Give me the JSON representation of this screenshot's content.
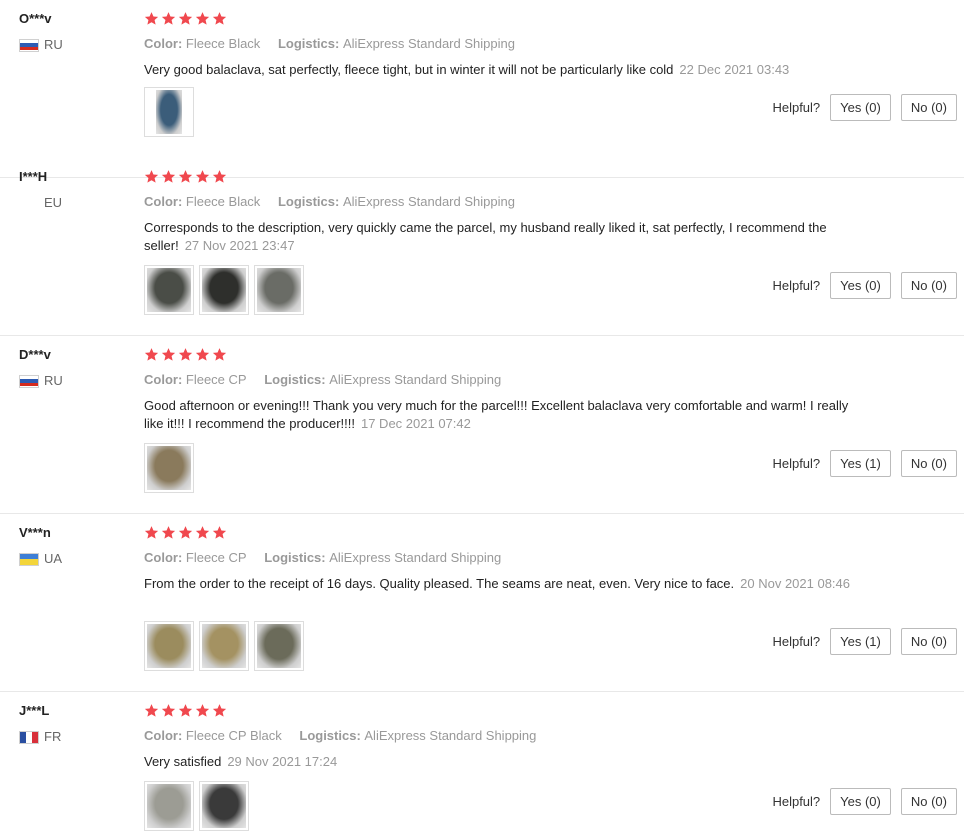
{
  "labels": {
    "color": "Color:",
    "logistics": "Logistics:",
    "helpful": "Helpful?"
  },
  "colors": {
    "star": "#f0484e",
    "text": "#222222",
    "muted": "#999999",
    "border": "#e8e8e8"
  },
  "reviews": [
    {
      "user": "O***v",
      "country": "RU",
      "flag_icon": "russia-flag-icon",
      "rating": 5,
      "color": "Fleece Black",
      "logistics": "AliExpress Standard Shipping",
      "text": "Very good balaclava, sat perfectly, fleece tight, but in winter it will not be particularly like cold",
      "date": "22 Dec 2021 03:43",
      "photo_count": 1,
      "yes": "Yes (0)",
      "no": "No (0)"
    },
    {
      "user": "I***H",
      "country": "EU",
      "flag_icon": "",
      "rating": 5,
      "color": "Fleece Black",
      "logistics": "AliExpress Standard Shipping",
      "text": "Corresponds to the description, very quickly came the parcel, my husband really liked it, sat perfectly, I recommend the seller!",
      "date": "27 Nov 2021 23:47",
      "photo_count": 3,
      "yes": "Yes (0)",
      "no": "No (0)"
    },
    {
      "user": "D***v",
      "country": "RU",
      "flag_icon": "russia-flag-icon",
      "rating": 5,
      "color": "Fleece CP",
      "logistics": "AliExpress Standard Shipping",
      "text": "Good afternoon or evening!!! Thank you very much for the parcel!!! Excellent balaclava very comfortable and warm! I really like it!!! I recommend the producer!!!!",
      "date": "17 Dec 2021 07:42",
      "photo_count": 1,
      "yes": "Yes (1)",
      "no": "No (0)"
    },
    {
      "user": "V***n",
      "country": "UA",
      "flag_icon": "ukraine-flag-icon",
      "rating": 5,
      "color": "Fleece CP",
      "logistics": "AliExpress Standard Shipping",
      "text": "From the order to the receipt of 16 days. Quality pleased. The seams are neat, even. Very nice to face.",
      "date": "20 Nov 2021 08:46",
      "photo_count": 3,
      "yes": "Yes (1)",
      "no": "No (0)"
    },
    {
      "user": "J***L",
      "country": "FR",
      "flag_icon": "france-flag-icon",
      "rating": 5,
      "color": "Fleece CP Black",
      "logistics": "AliExpress Standard Shipping",
      "text": "Very satisfied",
      "date": "29 Nov 2021 17:24",
      "photo_count": 2,
      "yes": "Yes (0)",
      "no": "No (0)"
    }
  ]
}
